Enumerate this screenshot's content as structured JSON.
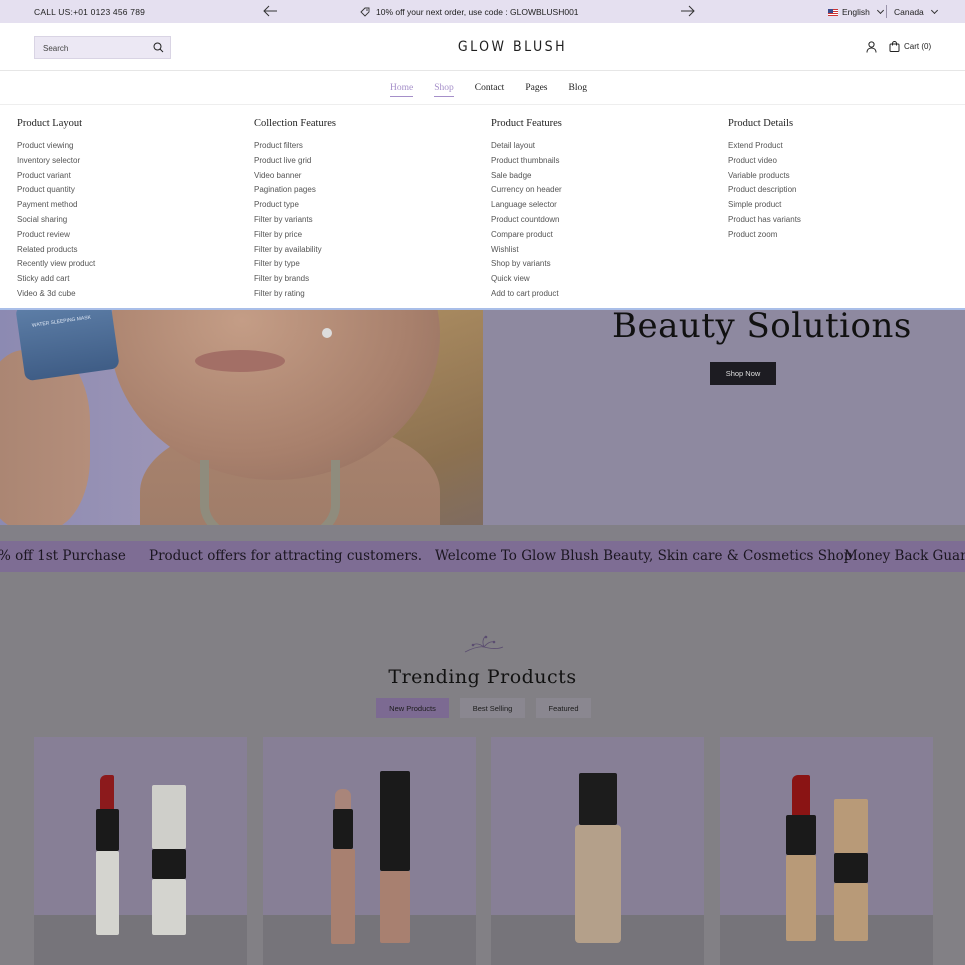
{
  "topbar": {
    "call": "CALL US:+01 0123 456 789",
    "promo": "10% off your next order, use code : GLOWBLUSH001",
    "language": "English",
    "country": "Canada"
  },
  "header": {
    "search_placeholder": "Search",
    "logo": "GLOW BLUSH",
    "cart_label": "Cart (0)"
  },
  "nav": {
    "items": [
      "Home",
      "Shop",
      "Contact",
      "Pages",
      "Blog"
    ]
  },
  "mega_menu": {
    "columns": [
      {
        "title": "Product Layout",
        "links": [
          "Product viewing",
          "Inventory selector",
          "Product variant",
          "Product quantity",
          "Payment method",
          "Social sharing",
          "Product review",
          "Related products",
          "Recently view product",
          "Sticky add cart",
          "Video & 3d cube"
        ]
      },
      {
        "title": "Collection Features",
        "links": [
          "Product filters",
          "Product live grid",
          "Video banner",
          "Pagination pages",
          "Product type",
          "Filter by variants",
          "Filter by price",
          "Filter by availability",
          "Filter by type",
          "Filter by brands",
          "Filter by rating"
        ]
      },
      {
        "title": "Product Features",
        "links": [
          "Detail layout",
          "Product thumbnails",
          "Sale badge",
          "Currency on header",
          "Language selector",
          "Product countdown",
          "Compare product",
          "Wishlist",
          "Shop by variants",
          "Quick view",
          "Add to cart product"
        ]
      },
      {
        "title": "Product Details",
        "links": [
          "Extend Product",
          "Product video",
          "Variable products",
          "Product description",
          "Simple product",
          "Product has variants",
          "Product zoom"
        ]
      }
    ]
  },
  "hero": {
    "title": "Beauty Solutions",
    "button": "Shop Now",
    "jar_text": "WATER SLEEPING MASK"
  },
  "marquee": {
    "items": [
      "% off 1st Purchase",
      "Product offers for attracting customers.",
      "Welcome To Glow Blush Beauty, Skin care & Cosmetics Shop",
      "Money Back Guaran"
    ]
  },
  "products": {
    "title": "Trending Products",
    "tabs": [
      "New Products",
      "Best Selling",
      "Featured"
    ]
  },
  "colors": {
    "accent": "#a58fc9",
    "topbar_bg": "#e5e0f0",
    "marquee_bg": "#7e6d94"
  }
}
